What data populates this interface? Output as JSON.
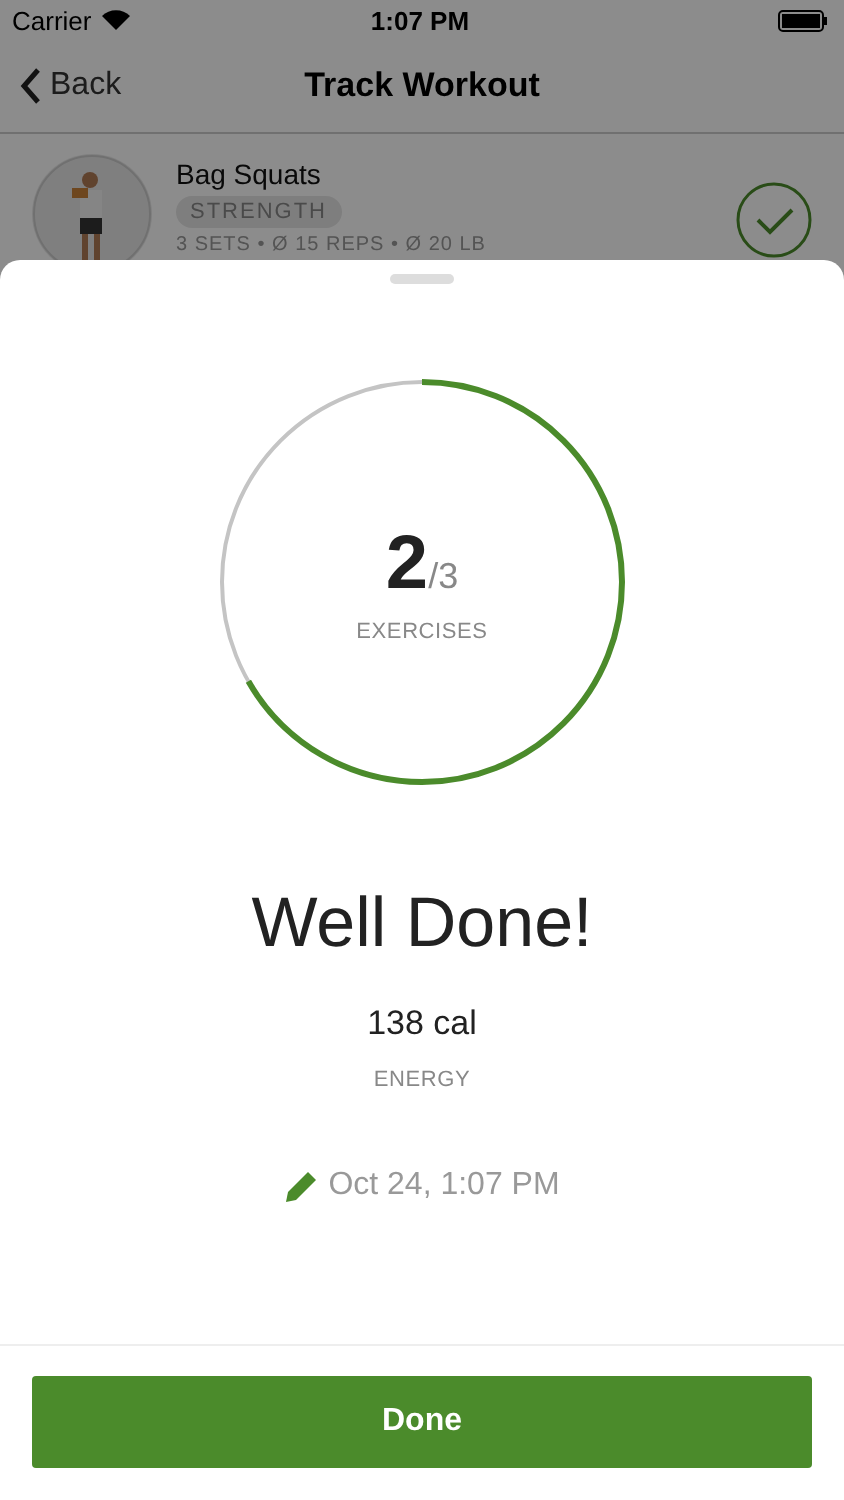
{
  "status_bar": {
    "carrier": "Carrier",
    "time": "1:07 PM"
  },
  "nav": {
    "back": "Back",
    "title": "Track Workout"
  },
  "exercise": {
    "kind": "picture",
    "name": "Bag Squats",
    "tag": "STRENGTH",
    "details": "3 SETS • Ø 15 REPS • Ø 20 LB",
    "completed": true
  },
  "summary": {
    "done_count": "2",
    "total": "/3",
    "label": "EXERCISES",
    "level": 0.667,
    "headline": "Well Done!",
    "energy": "138 cal",
    "energy_label": "ENERGY",
    "date": "Oct 24, 1:07 PM"
  },
  "button": "Done"
}
